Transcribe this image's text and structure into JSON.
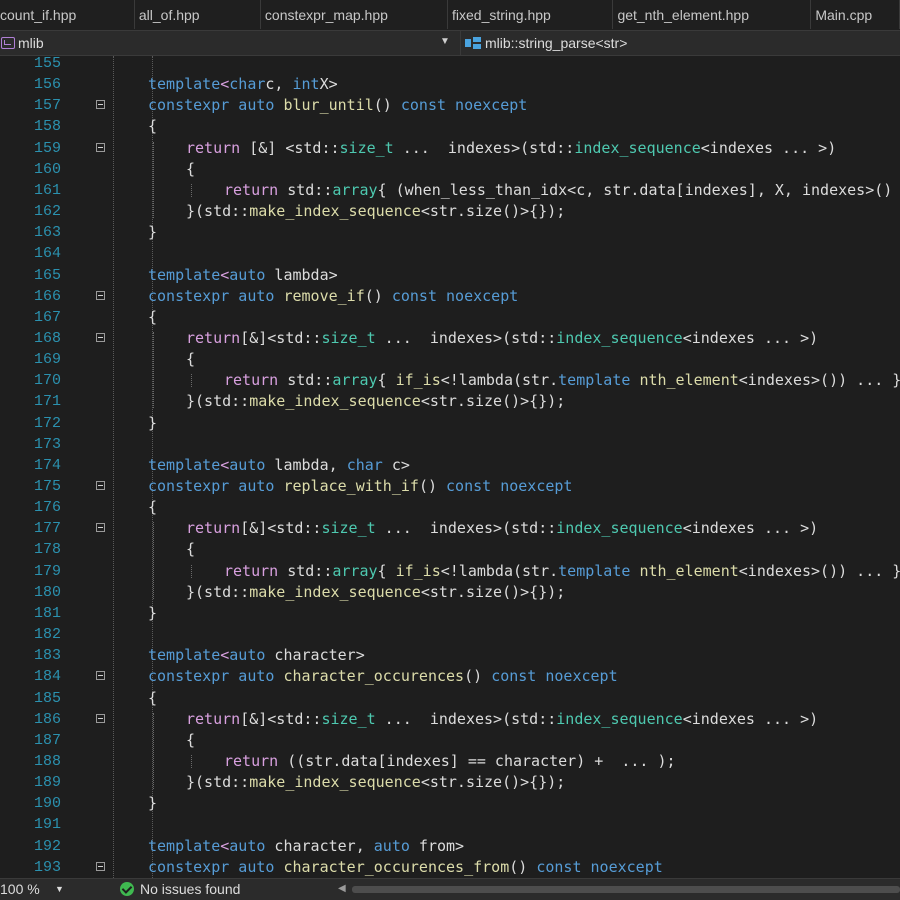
{
  "tabs": [
    "count_if.hpp",
    "all_of.hpp",
    "constexpr_map.hpp",
    "fixed_string.hpp",
    "get_nth_element.hpp",
    "Main.cpp"
  ],
  "navbar": {
    "project": "mlib",
    "scope": "mlib::string_parse<str>"
  },
  "editor": {
    "lines": [
      {
        "n": "155",
        "i": 0,
        "t": []
      },
      {
        "n": "156",
        "i": 1,
        "t": [
          [
            "kw",
            "template"
          ],
          [
            "cf",
            "<"
          ],
          [
            "kw",
            "char"
          ],
          [
            "",
            "c, "
          ],
          [
            "kw",
            "int"
          ],
          [
            "",
            "X>"
          ]
        ]
      },
      {
        "n": "157",
        "i": 1,
        "f": 1,
        "t": [
          [
            "kw",
            "constexpr auto"
          ],
          [
            "",
            " "
          ],
          [
            "fn",
            "blur_until"
          ],
          [
            "",
            "() "
          ],
          [
            "kw",
            "const noexcept"
          ]
        ]
      },
      {
        "n": "158",
        "i": 1,
        "t": [
          [
            "",
            "{"
          ]
        ]
      },
      {
        "n": "159",
        "i": 2,
        "f": 1,
        "t": [
          [
            "cf",
            "return"
          ],
          [
            "",
            " [&] <std::"
          ],
          [
            "ty",
            "size_t"
          ],
          [
            "",
            " ...  indexes>(std::"
          ],
          [
            "ty",
            "index_sequence"
          ],
          [
            "",
            "<indexes ... >)"
          ]
        ]
      },
      {
        "n": "160",
        "i": 2,
        "t": [
          [
            "",
            "{"
          ]
        ]
      },
      {
        "n": "161",
        "i": 3,
        "t": [
          [
            "cf",
            "return"
          ],
          [
            "",
            " std::"
          ],
          [
            "ty",
            "array"
          ],
          [
            "",
            "{ (when_less_than_idx<c, str.data[indexes], X, indexes>() ... ) };"
          ]
        ]
      },
      {
        "n": "162",
        "i": 2,
        "t": [
          [
            "",
            "}(std::"
          ],
          [
            "fn",
            "make_index_sequence"
          ],
          [
            "",
            "<str.size()>{});"
          ]
        ]
      },
      {
        "n": "163",
        "i": 1,
        "t": [
          [
            "",
            "}"
          ]
        ]
      },
      {
        "n": "164",
        "i": 0,
        "t": []
      },
      {
        "n": "165",
        "i": 1,
        "t": [
          [
            "kw",
            "template"
          ],
          [
            "cf",
            "<"
          ],
          [
            "kw",
            "auto"
          ],
          [
            "",
            " lambda>"
          ]
        ]
      },
      {
        "n": "166",
        "i": 1,
        "f": 1,
        "t": [
          [
            "kw",
            "constexpr auto"
          ],
          [
            "",
            " "
          ],
          [
            "fn",
            "remove_if"
          ],
          [
            "",
            "() "
          ],
          [
            "kw",
            "const noexcept"
          ]
        ]
      },
      {
        "n": "167",
        "i": 1,
        "t": [
          [
            "",
            "{"
          ]
        ]
      },
      {
        "n": "168",
        "i": 2,
        "f": 1,
        "t": [
          [
            "cf",
            "return"
          ],
          [
            "",
            "[&]<std::"
          ],
          [
            "ty",
            "size_t"
          ],
          [
            "",
            " ...  indexes>(std::"
          ],
          [
            "ty",
            "index_sequence"
          ],
          [
            "",
            "<indexes ... >)"
          ]
        ]
      },
      {
        "n": "169",
        "i": 2,
        "t": [
          [
            "",
            "{"
          ]
        ]
      },
      {
        "n": "170",
        "i": 3,
        "t": [
          [
            "cf",
            "return"
          ],
          [
            "",
            " std::"
          ],
          [
            "ty",
            "array"
          ],
          [
            "",
            "{ "
          ],
          [
            "fn",
            "if_is"
          ],
          [
            "",
            "<!lambda(str."
          ],
          [
            "kw",
            "template"
          ],
          [
            "",
            " "
          ],
          [
            "fn",
            "nth_element"
          ],
          [
            "",
            "<indexes>()) ... };"
          ]
        ]
      },
      {
        "n": "171",
        "i": 2,
        "t": [
          [
            "",
            "}(std::"
          ],
          [
            "fn",
            "make_index_sequence"
          ],
          [
            "",
            "<str.size()>{});"
          ]
        ]
      },
      {
        "n": "172",
        "i": 1,
        "t": [
          [
            "",
            "}"
          ]
        ]
      },
      {
        "n": "173",
        "i": 0,
        "t": []
      },
      {
        "n": "174",
        "i": 1,
        "t": [
          [
            "kw",
            "template"
          ],
          [
            "cf",
            "<"
          ],
          [
            "kw",
            "auto"
          ],
          [
            "",
            " lambda, "
          ],
          [
            "kw",
            "char"
          ],
          [
            "",
            " c>"
          ]
        ]
      },
      {
        "n": "175",
        "i": 1,
        "f": 1,
        "t": [
          [
            "kw",
            "constexpr auto"
          ],
          [
            "",
            " "
          ],
          [
            "fn",
            "replace_with_if"
          ],
          [
            "",
            "() "
          ],
          [
            "kw",
            "const noexcept"
          ]
        ]
      },
      {
        "n": "176",
        "i": 1,
        "t": [
          [
            "",
            "{"
          ]
        ]
      },
      {
        "n": "177",
        "i": 2,
        "f": 1,
        "t": [
          [
            "cf",
            "return"
          ],
          [
            "",
            "[&]<std::"
          ],
          [
            "ty",
            "size_t"
          ],
          [
            "",
            " ...  indexes>(std::"
          ],
          [
            "ty",
            "index_sequence"
          ],
          [
            "",
            "<indexes ... >)"
          ]
        ]
      },
      {
        "n": "178",
        "i": 2,
        "t": [
          [
            "",
            "{"
          ]
        ]
      },
      {
        "n": "179",
        "i": 3,
        "t": [
          [
            "cf",
            "return"
          ],
          [
            "",
            " std::"
          ],
          [
            "ty",
            "array"
          ],
          [
            "",
            "{ "
          ],
          [
            "fn",
            "if_is"
          ],
          [
            "",
            "<!lambda(str."
          ],
          [
            "kw",
            "template"
          ],
          [
            "",
            " "
          ],
          [
            "fn",
            "nth_element"
          ],
          [
            "",
            "<indexes>()) ... };"
          ]
        ]
      },
      {
        "n": "180",
        "i": 2,
        "t": [
          [
            "",
            "}(std::"
          ],
          [
            "fn",
            "make_index_sequence"
          ],
          [
            "",
            "<str.size()>{});"
          ]
        ]
      },
      {
        "n": "181",
        "i": 1,
        "t": [
          [
            "",
            "}"
          ]
        ]
      },
      {
        "n": "182",
        "i": 0,
        "t": []
      },
      {
        "n": "183",
        "i": 1,
        "t": [
          [
            "kw",
            "template"
          ],
          [
            "cf",
            "<"
          ],
          [
            "kw",
            "auto"
          ],
          [
            "",
            " character>"
          ]
        ]
      },
      {
        "n": "184",
        "i": 1,
        "f": 1,
        "t": [
          [
            "kw",
            "constexpr auto"
          ],
          [
            "",
            " "
          ],
          [
            "fn",
            "character_occurences"
          ],
          [
            "",
            "() "
          ],
          [
            "kw",
            "const noexcept"
          ]
        ]
      },
      {
        "n": "185",
        "i": 1,
        "t": [
          [
            "",
            "{"
          ]
        ]
      },
      {
        "n": "186",
        "i": 2,
        "f": 1,
        "t": [
          [
            "cf",
            "return"
          ],
          [
            "",
            "[&]<std::"
          ],
          [
            "ty",
            "size_t"
          ],
          [
            "",
            " ...  indexes>(std::"
          ],
          [
            "ty",
            "index_sequence"
          ],
          [
            "",
            "<indexes ... >)"
          ]
        ]
      },
      {
        "n": "187",
        "i": 2,
        "t": [
          [
            "",
            "{"
          ]
        ]
      },
      {
        "n": "188",
        "i": 3,
        "t": [
          [
            "cf",
            "return"
          ],
          [
            "",
            " ((str.data[indexes] == character) +  ... );"
          ]
        ]
      },
      {
        "n": "189",
        "i": 2,
        "t": [
          [
            "",
            "}(std::"
          ],
          [
            "fn",
            "make_index_sequence"
          ],
          [
            "",
            "<str.size()>{});"
          ]
        ]
      },
      {
        "n": "190",
        "i": 1,
        "t": [
          [
            "",
            "}"
          ]
        ]
      },
      {
        "n": "191",
        "i": 0,
        "t": []
      },
      {
        "n": "192",
        "i": 1,
        "t": [
          [
            "kw",
            "template"
          ],
          [
            "cf",
            "<"
          ],
          [
            "kw",
            "auto"
          ],
          [
            "",
            " character, "
          ],
          [
            "kw",
            "auto"
          ],
          [
            "",
            " from>"
          ]
        ]
      },
      {
        "n": "193",
        "i": 1,
        "f": 1,
        "t": [
          [
            "kw",
            "constexpr auto"
          ],
          [
            "",
            " "
          ],
          [
            "fn",
            "character_occurences_from"
          ],
          [
            "",
            "() "
          ],
          [
            "kw",
            "const noexcept"
          ]
        ]
      }
    ]
  },
  "statusbar": {
    "zoom": "100 %",
    "issues": "No issues found"
  },
  "colors": {
    "keyword": "#569cd6",
    "control": "#d8a0df",
    "type": "#4ec9b0",
    "function": "#dcdcaa",
    "line_number": "#2b91af",
    "ok": "#3fb950"
  },
  "icons": [
    "solution-project-icon",
    "scope-member-icon",
    "zoom-dropdown-icon",
    "ok-check-icon",
    "fold-collapse-icon"
  ]
}
